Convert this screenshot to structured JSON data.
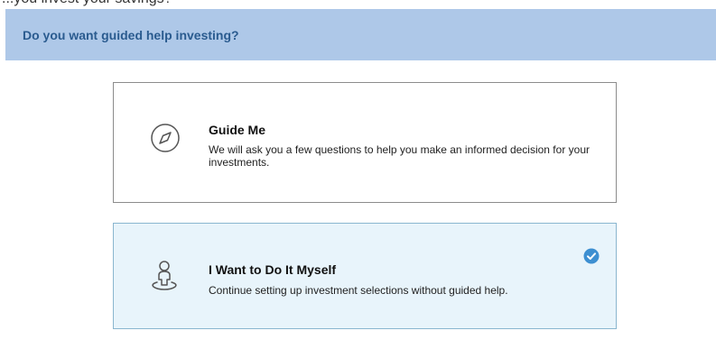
{
  "header": {
    "partial_text_above": "...you invest your savings?",
    "title": "Do you want guided help investing?"
  },
  "options": [
    {
      "title": "Guide Me",
      "description": "We will ask you a few questions to help you make an informed decision for your investments.",
      "icon": "compass-icon",
      "selected": false
    },
    {
      "title": "I Want to Do It Myself",
      "description": "Continue setting up investment selections without guided help.",
      "icon": "person-pin-icon",
      "selected": true
    }
  ],
  "colors": {
    "header_background": "#aec8e8",
    "header_text": "#2a5b8f",
    "selected_card_background": "#e8f4fb",
    "selected_card_border": "#8ab6cf",
    "check_badge": "#3d8fd1",
    "icon_stroke": "#555555"
  }
}
